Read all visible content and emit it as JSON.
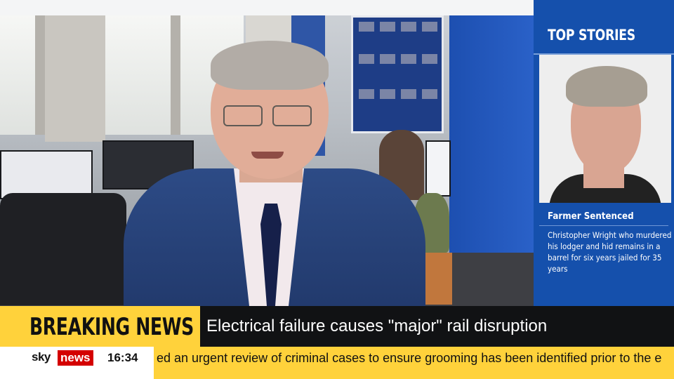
{
  "top_stories": {
    "title": "TOP STORIES",
    "story_headline": "Farmer Sentenced",
    "story_body": "Christopher Wright who murdered his lodger and hid remains in a barrel for six years jailed for 35 years"
  },
  "breaking_news": {
    "label": "BREAKING NEWS",
    "headline": "Electrical failure causes \"major\" rail disruption"
  },
  "ticker": {
    "brand_sky": "sky",
    "brand_news": "news",
    "time": "16:34",
    "crawl_text": "ed an urgent review of criminal cases to ensure grooming has been identified prior to the e"
  },
  "colors": {
    "sidebar_blue": "#1550ac",
    "breaking_yellow": "#ffd23b",
    "headline_black": "#111214",
    "brand_red": "#d40000"
  }
}
